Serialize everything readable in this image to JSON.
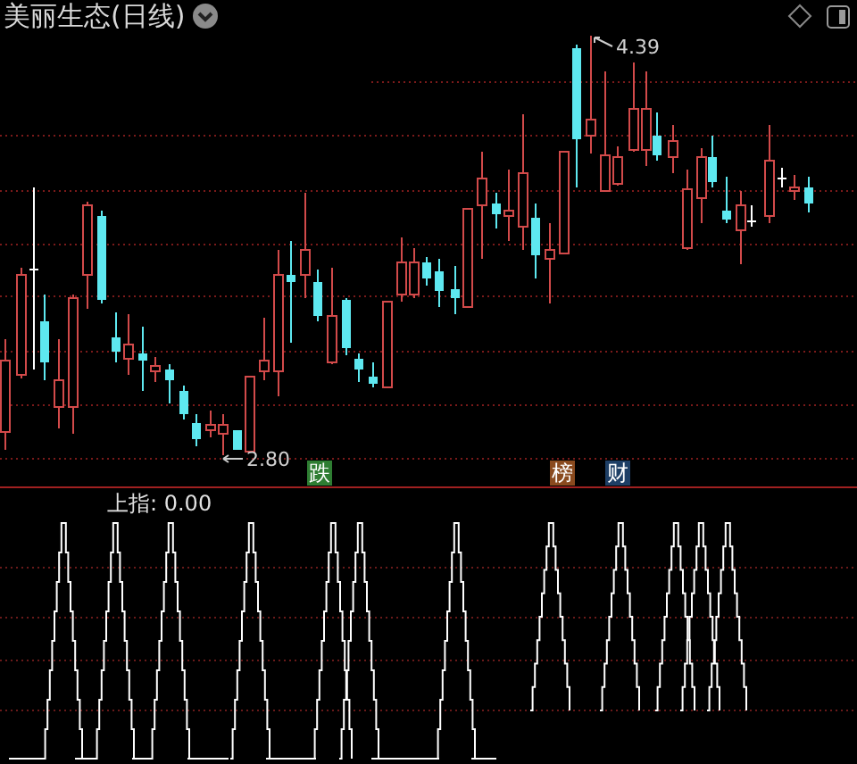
{
  "title": "美丽生态(日线)",
  "price_chart": {
    "high_label": "4.39",
    "low_label": "2.80",
    "tags": [
      {
        "text": "跌",
        "color": "#2e7d32"
      },
      {
        "text": "榜",
        "color": "#8a4a1e"
      },
      {
        "text": "财",
        "color": "#1e3f66"
      }
    ]
  },
  "indicator": {
    "label": "上指: 0.00"
  }
}
